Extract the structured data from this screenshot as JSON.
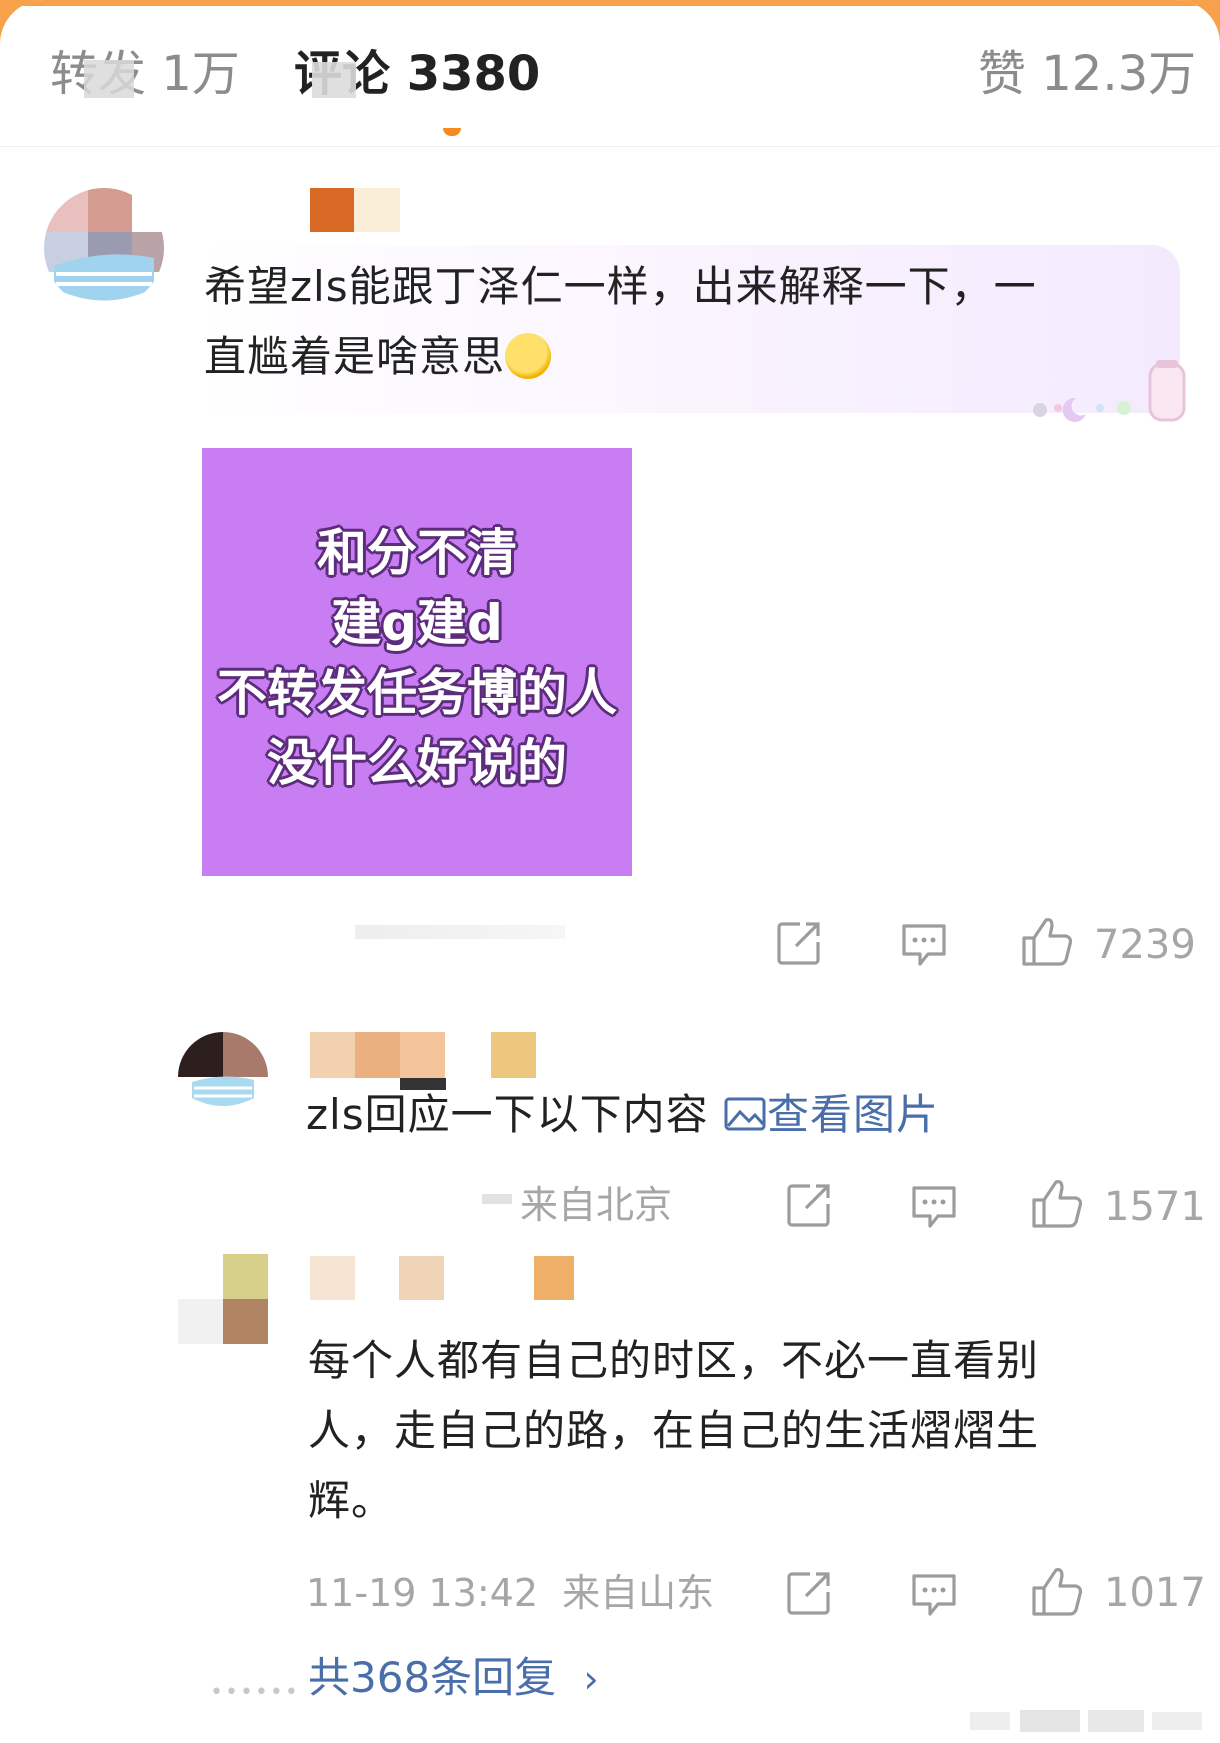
{
  "tabs": [
    {
      "label": "转发 1万"
    },
    {
      "label": "评论 3380"
    },
    {
      "label": "赞 12.3万"
    }
  ],
  "comment1": {
    "text_line1": "希望zls能跟丁泽仁一样，出来解释一下，一",
    "text_line2": "直尴着是啥意思",
    "emoji": "crying-face-emoji",
    "image_text": [
      "和分不清",
      "建g建d",
      "不转发任务博的人",
      "没什么好说的"
    ],
    "image_bg": "#c97df3",
    "like_count": "7239"
  },
  "reply1": {
    "text": "zls回应一下以下内容",
    "link": "查看图片",
    "location": "来自北京",
    "like_count": "1571"
  },
  "reply2": {
    "text_line1": "每个人都有自己的时区，不必一直看别",
    "text_line2": "人，走自己的路，在自己的生活熠熠生",
    "text_line3": "辉。",
    "time": "11-19 13:42",
    "location": "来自山东",
    "like_count": "1017"
  },
  "more_replies": "共368条回复",
  "colors": {
    "accent": "#f78a1e",
    "link": "#4a6ea9",
    "meta": "#a6a6a6"
  }
}
